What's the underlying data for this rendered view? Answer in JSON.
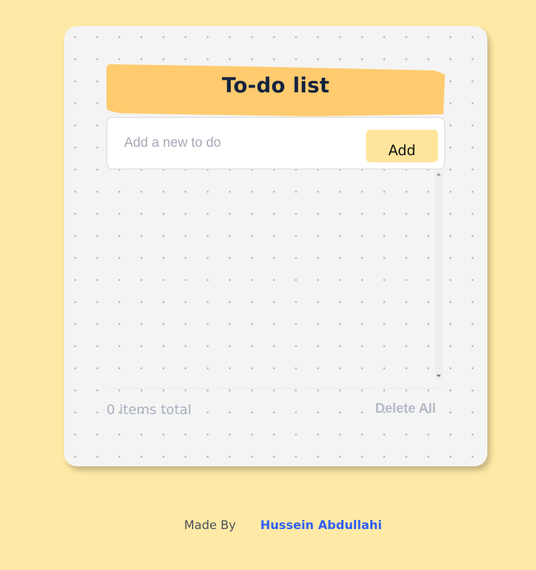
{
  "header": {
    "title": "To-do list"
  },
  "new_todo": {
    "value": "",
    "placeholder": "Add a new to do",
    "add_label": "Add"
  },
  "todo_list": {
    "items": []
  },
  "summary": {
    "items_total": "0 items total",
    "delete_all_label": "Delete All"
  },
  "footer": {
    "made_by": "Made By",
    "author": "Hussein Abdullahi"
  },
  "colors": {
    "page_background": "#ffe9a6",
    "card_background": "#f4f4f4",
    "title_banner": "#ffcb6e",
    "add_button": "#ffe49b",
    "author_link": "#2f5ff5"
  }
}
